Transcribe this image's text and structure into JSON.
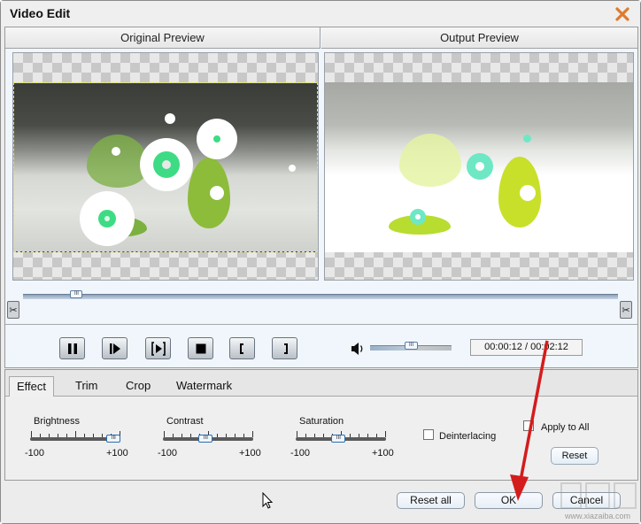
{
  "window": {
    "title": "Video Edit",
    "close_icon": "close-x-icon",
    "accent_color": "#e07a2e"
  },
  "preview": {
    "original_label": "Original Preview",
    "output_label": "Output Preview"
  },
  "timeline": {
    "position_fraction": 0.09,
    "start_marker_icon": "scissors-icon",
    "end_marker_icon": "scissors-icon"
  },
  "playback": {
    "buttons": [
      {
        "name": "pause",
        "icon": "pause-icon"
      },
      {
        "name": "play-next-frame",
        "icon": "step-play-icon"
      },
      {
        "name": "play-segment",
        "icon": "bracket-play-icon"
      },
      {
        "name": "stop",
        "icon": "stop-icon"
      },
      {
        "name": "set-start",
        "icon": "left-bracket-icon"
      },
      {
        "name": "set-end",
        "icon": "right-bracket-icon"
      }
    ],
    "volume_icon": "speaker-icon",
    "volume_fraction": 0.5,
    "time_display": "00:00:12 / 00:02:12"
  },
  "tabs": [
    {
      "label": "Effect",
      "active": true
    },
    {
      "label": "Trim",
      "active": false
    },
    {
      "label": "Crop",
      "active": false
    },
    {
      "label": "Watermark",
      "active": false
    }
  ],
  "effect": {
    "sliders": [
      {
        "label": "Brightness",
        "min_label": "-100",
        "max_label": "+100",
        "value": 85
      },
      {
        "label": "Contrast",
        "min_label": "-100",
        "max_label": "+100",
        "value": -5
      },
      {
        "label": "Saturation",
        "min_label": "-100",
        "max_label": "+100",
        "value": -5
      }
    ],
    "deinterlacing_label": "Deinterlacing",
    "deinterlacing_checked": false,
    "apply_to_all_label": "Apply to All",
    "apply_to_all_checked": false,
    "reset_label": "Reset"
  },
  "footer": {
    "reset_all_label": "Reset all",
    "ok_label": "OK",
    "cancel_label": "Cancel"
  },
  "annotation": {
    "arrow_color": "#d41c1c"
  },
  "watermark": {
    "text": "www.xiazaiba.com"
  }
}
